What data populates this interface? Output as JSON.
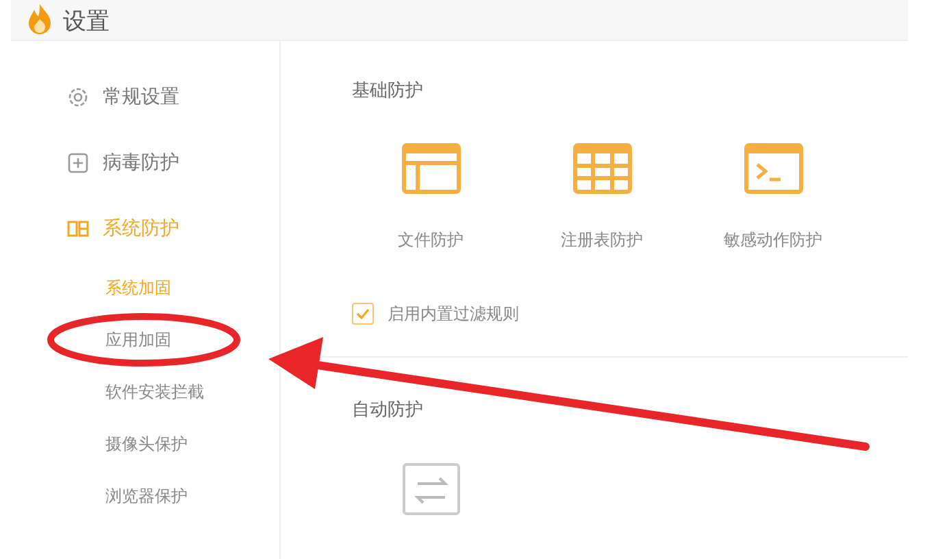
{
  "window": {
    "title": "设置"
  },
  "sidebar": {
    "items": [
      {
        "label": "常规设置",
        "kind": "gear",
        "selected": false
      },
      {
        "label": "病毒防护",
        "kind": "plus",
        "selected": false
      },
      {
        "label": "系统防护",
        "kind": "grid",
        "selected": true,
        "children": [
          {
            "label": "系统加固",
            "selected": true
          },
          {
            "label": "应用加固",
            "selected": false
          },
          {
            "label": "软件安装拦截",
            "selected": false
          },
          {
            "label": "摄像头保护",
            "selected": false
          },
          {
            "label": "浏览器保护",
            "selected": false
          }
        ]
      }
    ]
  },
  "sections": [
    {
      "title": "基础防护",
      "tiles": [
        {
          "label": "文件防护",
          "kind": "file"
        },
        {
          "label": "注册表防护",
          "kind": "table"
        },
        {
          "label": "敏感动作防护",
          "kind": "console"
        }
      ],
      "checkbox": {
        "label": "启用内置过滤规则",
        "checked": true
      }
    },
    {
      "title": "自动防护",
      "tiles": [
        {
          "kind": "sync"
        }
      ]
    }
  ]
}
